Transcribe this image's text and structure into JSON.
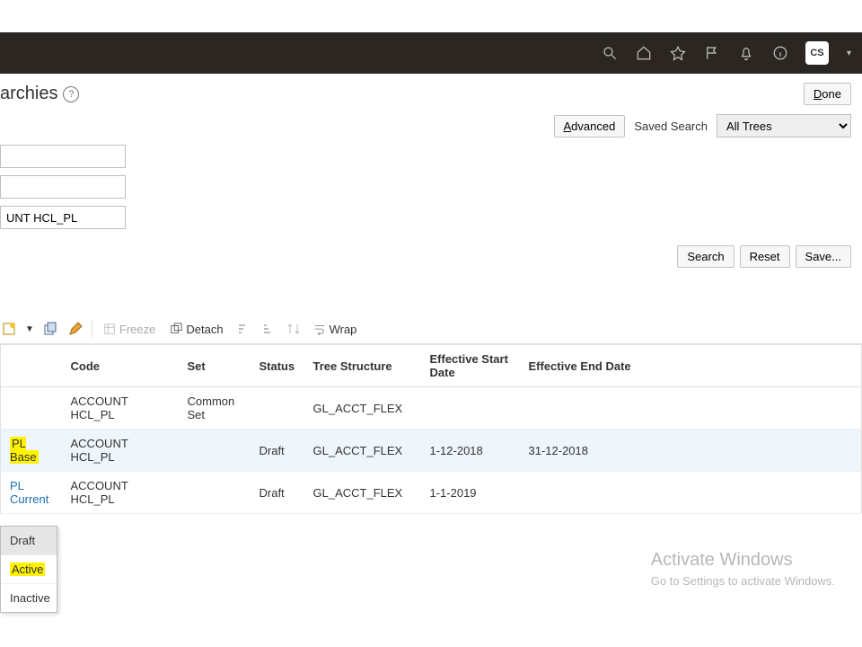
{
  "topbar": {
    "avatar": "CS"
  },
  "page": {
    "title_partial": "archies",
    "help_glyph": "?"
  },
  "done_label": "Done",
  "search_bar": {
    "advanced_label": "Advanced",
    "saved_label": "Saved Search",
    "saved_option": "All Trees"
  },
  "search_fields": {
    "f1_value": "",
    "f2_value": "",
    "f3_value": "UNT HCL_PL"
  },
  "search_buttons": {
    "search": "Search",
    "reset": "Reset",
    "save": "Save..."
  },
  "toolbar": {
    "freeze": "Freeze",
    "detach": "Detach",
    "wrap": "Wrap"
  },
  "table": {
    "headers": {
      "name": "",
      "code": "Code",
      "set": "Set",
      "status": "Status",
      "tree": "Tree Structure",
      "start": "Effective Start Date",
      "end": "Effective End Date"
    },
    "rows": [
      {
        "name": "",
        "code": "ACCOUNT HCL_PL",
        "set": "Common Set",
        "status": "",
        "tree": "GL_ACCT_FLEX",
        "start": "",
        "end": ""
      },
      {
        "name": "PL Base",
        "code": "ACCOUNT HCL_PL",
        "set": "",
        "status": "Draft",
        "tree": "GL_ACCT_FLEX",
        "start": "1-12-2018",
        "end": "31-12-2018"
      },
      {
        "name": "PL Current",
        "code": "ACCOUNT HCL_PL",
        "set": "",
        "status": "Draft",
        "tree": "GL_ACCT_FLEX",
        "start": "1-1-2019",
        "end": ""
      }
    ]
  },
  "status_menu": {
    "draft": "Draft",
    "active": "Active",
    "inactive": "Inactive"
  },
  "watermark": {
    "l1": "Activate Windows",
    "l2": "Go to Settings to activate Windows."
  }
}
